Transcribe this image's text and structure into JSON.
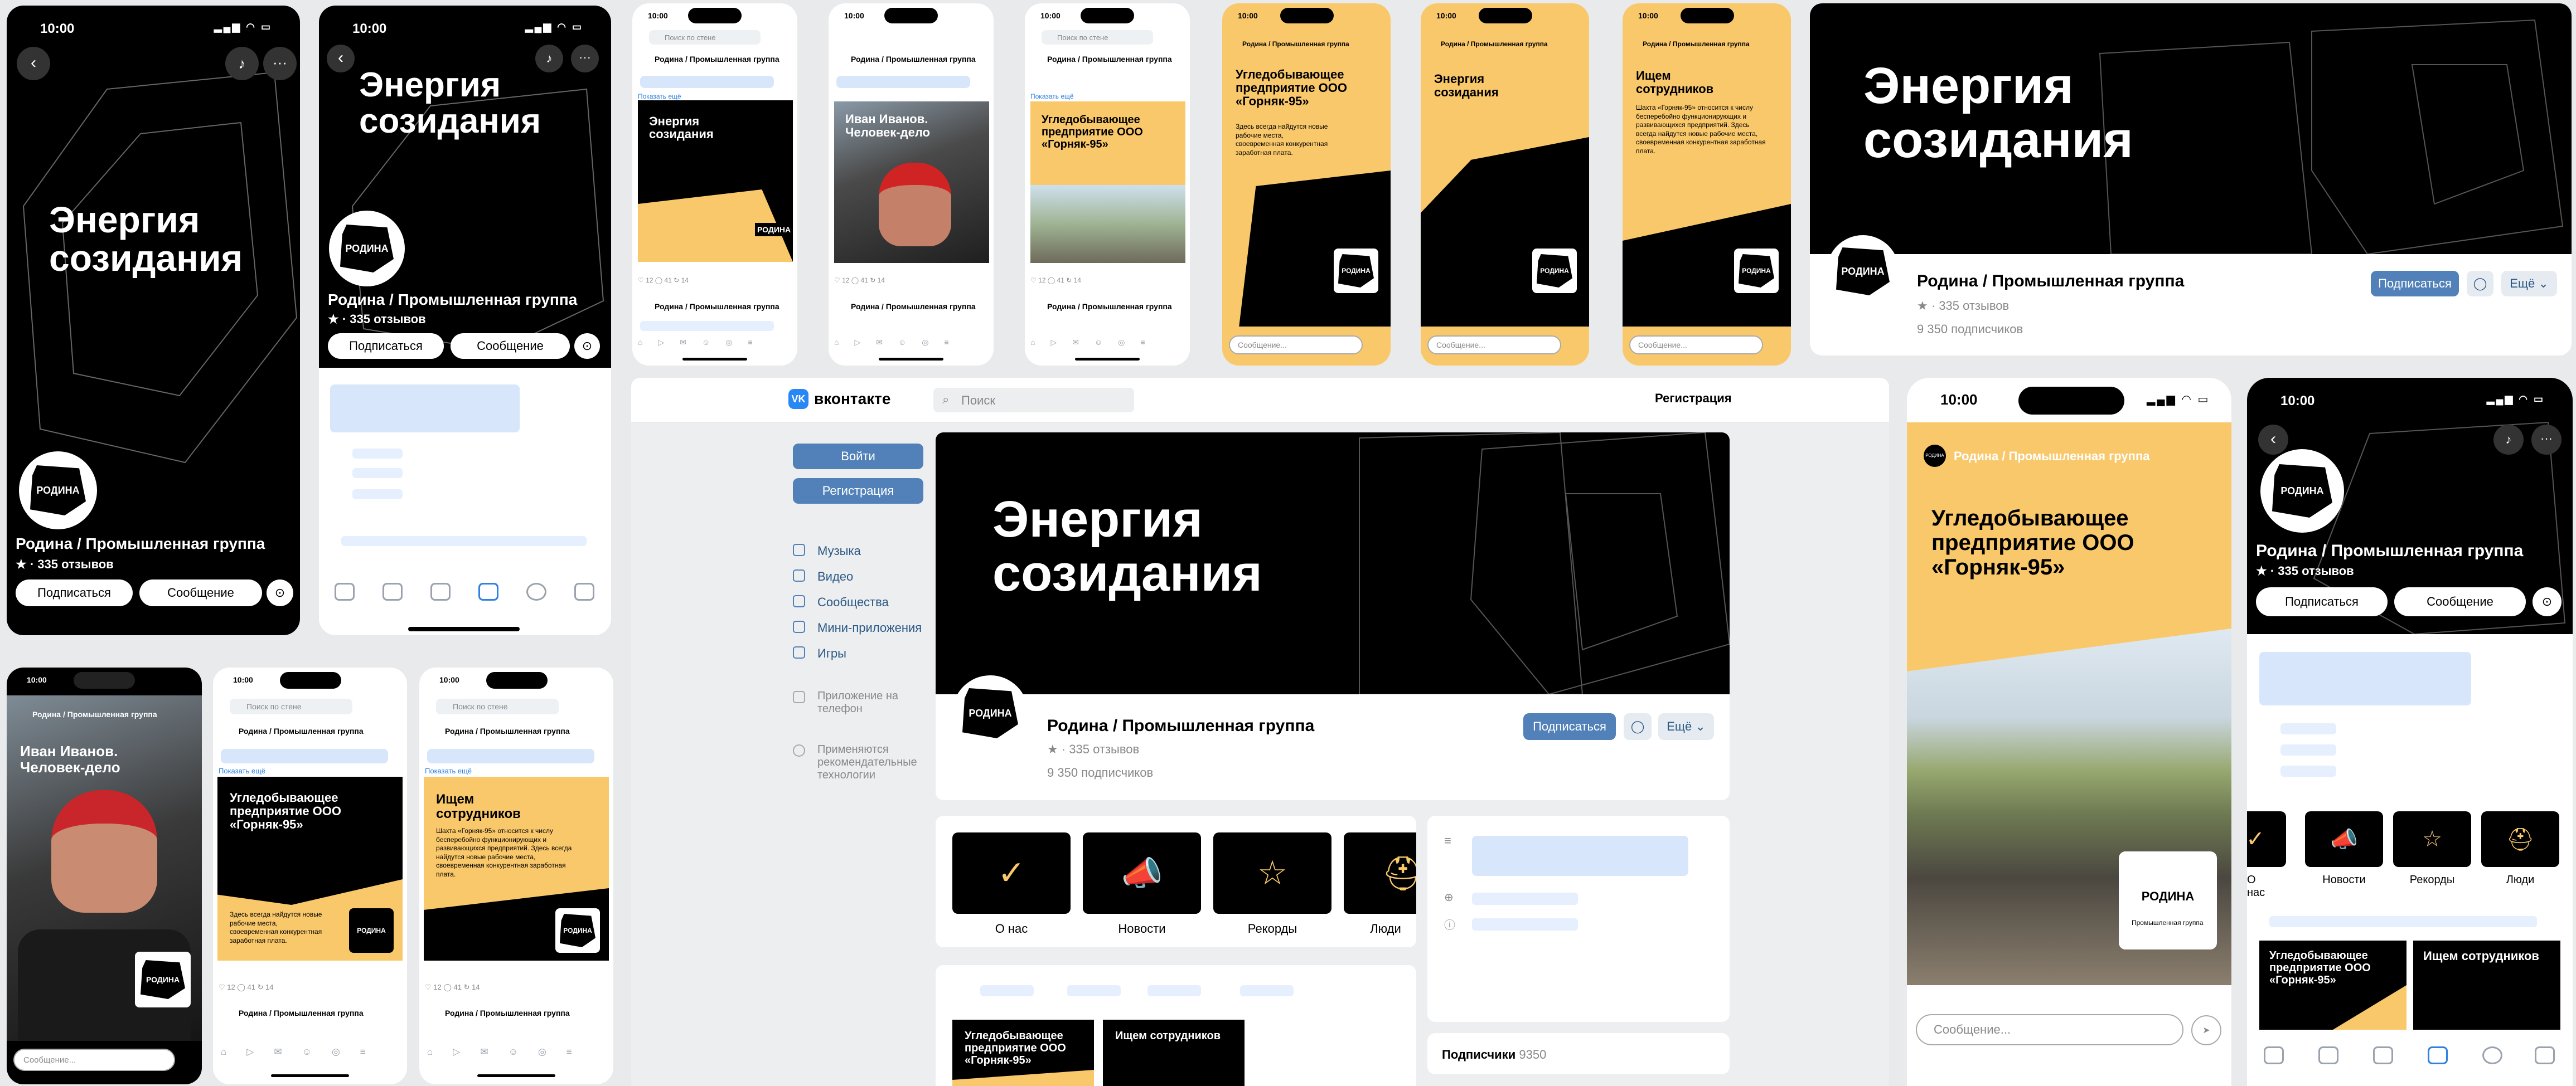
{
  "status_time": "10:00",
  "brand": {
    "slogan": "Энергия созидания",
    "logo_text": "РОДИНА",
    "logo_sub": "Промышленная группа"
  },
  "community": {
    "name": "Родина / Промышленная группа",
    "reviews": "335 отзывов",
    "subscribers": "9 350 подписчиков",
    "subscribers_label": "Подписчики",
    "subscribers_count": "9350"
  },
  "buttons": {
    "subscribe": "Подписаться",
    "message": "Сообщение",
    "more": "Ещё",
    "login": "Войти",
    "register": "Регистрация"
  },
  "posts": {
    "coal": "Угледобывающее предприятие ООО «Горняк-95»",
    "coal_body": "Здесь всегда найдутся новые рабочие места, своевременная конкурентная заработная плата.",
    "ivan": "Иван Иванов. Человек-дело",
    "hiring": "Ищем сотрудников",
    "hiring_body": "Шахта «Горняк-95» относится к числу бесперебойно функционирующих и развивающихся предприятий. Здесь всегда найдутся новые рабочие места, своевременная конкурентная заработная плата.",
    "show_more": "Показать ещё",
    "wall_search": "Поиск по стене"
  },
  "story_input": "Сообщение...",
  "vk": {
    "logo": "вконтакте",
    "search": "Поиск",
    "register": "Регистрация",
    "menu": [
      "Музыка",
      "Видео",
      "Сообщества",
      "Мини-приложения",
      "Игры"
    ],
    "app_link": "Приложение на телефон",
    "tech_link": "Применяются рекомендательные технологии"
  },
  "tiles": [
    "О нас",
    "Новости",
    "Рекорды",
    "Люди"
  ],
  "colors": {
    "accent_yellow": "#f9c86b",
    "vk_blue": "#5181b8",
    "placeholder": "#d7e6fb"
  }
}
